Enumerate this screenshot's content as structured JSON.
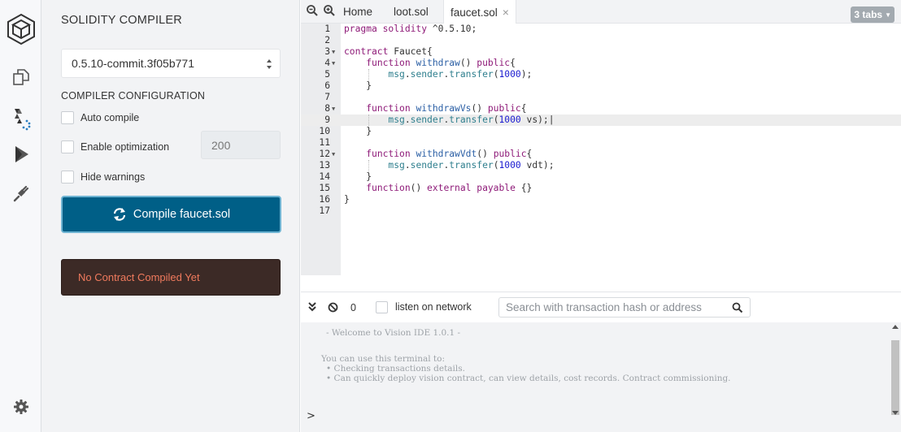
{
  "rail": {
    "icons": [
      "vision-logo-icon",
      "file-explorer-icon",
      "solidity-compiler-icon",
      "deploy-run-icon",
      "plugin-manager-icon",
      "settings-icon"
    ]
  },
  "compiler": {
    "title": "SOLIDITY COMPILER",
    "version": "0.5.10-commit.3f05b771",
    "config_title": "COMPILER CONFIGURATION",
    "auto_compile": "Auto compile",
    "enable_optimization": "Enable optimization",
    "runs": "200",
    "hide_warnings": "Hide warnings",
    "compile_button": "Compile faucet.sol",
    "status": "No Contract Compiled Yet"
  },
  "editor": {
    "tabs": [
      {
        "label": "Home",
        "active": false
      },
      {
        "label": "loot.sol",
        "active": false
      },
      {
        "label": "faucet.sol",
        "active": true,
        "close": "×"
      }
    ],
    "tabs_count": "3 tabs",
    "line_numbers": [
      "1",
      "2",
      "3",
      "4",
      "5",
      "6",
      "7",
      "8",
      "9",
      "10",
      "11",
      "12",
      "13",
      "14",
      "15",
      "16",
      "17"
    ],
    "highlighted_line": 9
  },
  "terminal": {
    "count": "0",
    "listen_label": "listen on network",
    "search_placeholder": "Search with transaction hash or address",
    "welcome": "- Welcome to Vision IDE 1.0.1 -",
    "intro": "You can use this terminal to:",
    "bullets": [
      "Checking transactions details.",
      "Can quickly deploy vision contract, can view details, cost records. Contract commissioning."
    ],
    "prompt": ">"
  }
}
